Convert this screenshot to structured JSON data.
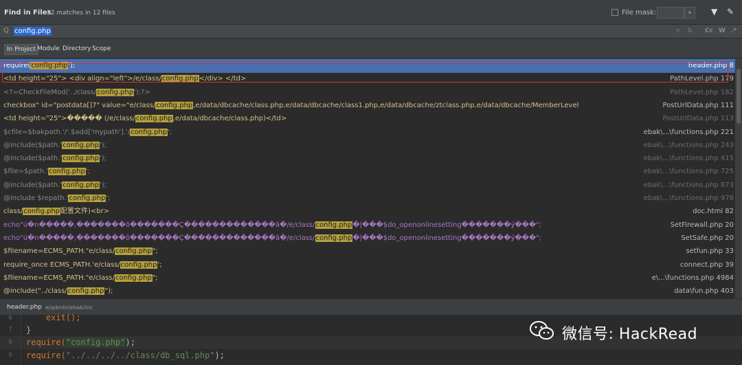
{
  "window": {
    "title": "Find in Files",
    "subtitle": "32 matches in 12 files",
    "file_mask_label": "File mask:",
    "file_mask_value": ""
  },
  "search": {
    "query": "config.php",
    "case_label": "Cc",
    "word_label": "W",
    "regex_label": ".*"
  },
  "scopes": [
    "In Project",
    "Module",
    "Directory",
    "Scope"
  ],
  "results": [
    {
      "pre": "require(",
      "match": "config.php",
      "post": "');",
      "loc": "header.php 8",
      "style": "normal",
      "loc_dim": false
    },
    {
      "pre": "<td height=\"25\">  <div align=\"left\">/e/class/",
      "match": "config.php",
      "post": "</div> </td>",
      "loc": "PathLevel.php 179",
      "style": "normal",
      "loc_dim": false
    },
    {
      "pre": "<?=CheckFileMod('../class/",
      "match": "config.php",
      "post": "');?>",
      "loc": "PathLevel.php 182",
      "style": "dim",
      "loc_dim": true
    },
    {
      "pre": "checkbox\" id=\"postdata[]7\" value=\"e/class/",
      "match": "config.php",
      "post": ",e/data/dbcache/class.php,e/data/dbcache/class1.php,e/data/dbcache/ztclass.php,e/data/dbcache/MemberLevel",
      "loc": "PostUrlData.php 111",
      "style": "normal",
      "loc_dim": false
    },
    {
      "pre": "<td height=\"25\">�����  (/e/class/",
      "match": "config.php",
      "post": ",e/data/dbcache/class.php)</td>",
      "loc": "PostUrlData.php 113",
      "style": "normal",
      "loc_dim": true
    },
    {
      "pre": "$cfile=$bakpath.'/'.$add['mypath'].'/",
      "match": "config.php",
      "post": "';",
      "loc": "ebak\\...\\functions.php 221",
      "style": "dim",
      "loc_dim": false
    },
    {
      "pre": "@include($path.'",
      "match": "config.php",
      "post": "');",
      "loc": "ebak\\...\\functions.php 243",
      "style": "dim",
      "loc_dim": true
    },
    {
      "pre": "@include($path.'",
      "match": "config.php",
      "post": "');",
      "loc": "ebak\\...\\functions.php 415",
      "style": "dim",
      "loc_dim": true
    },
    {
      "pre": "$file=$path.'",
      "match": "config.php",
      "post": "';",
      "loc": "ebak\\...\\functions.php 725",
      "style": "dim",
      "loc_dim": true
    },
    {
      "pre": "@include($path.'",
      "match": "config.php",
      "post": "');",
      "loc": "ebak\\...\\functions.php 873",
      "style": "dim",
      "loc_dim": true
    },
    {
      "pre": "@include $repath.'",
      "match": "config.php",
      "post": "';",
      "loc": "ebak\\...\\functions.php 978",
      "style": "dim",
      "loc_dim": true
    },
    {
      "pre": "class/",
      "match": "config.php",
      "post": "配置文件)<br>",
      "loc": "doc.html 82",
      "style": "normal",
      "loc_dim": false
    },
    {
      "pre": "echo\"ú�n�����,�������ô�������Ç�������������ã�/e/class/",
      "match": "config.php",
      "post": "�|���$do_openonlinesetting�������ý���\";",
      "loc": "SetFirewall.php 20",
      "style": "purple",
      "loc_dim": false
    },
    {
      "pre": "echo\"ú�n�����,�������ô�������Ç�������������ã�/e/class/",
      "match": "config.php",
      "post": "�|���$do_openonlinesetting�������ý���\";",
      "loc": "SetSafe.php 20",
      "style": "purple",
      "loc_dim": false
    },
    {
      "pre": "$filename=ECMS_PATH.\"e/class/",
      "match": "config.php",
      "post": "\";",
      "loc": "setfun.php 33",
      "style": "normal",
      "loc_dim": false
    },
    {
      "pre": "require_once ECMS_PATH.'e/class/",
      "match": "config.php",
      "post": "';",
      "loc": "connect.php 39",
      "style": "normal",
      "loc_dim": false
    },
    {
      "pre": "$filename=ECMS_PATH.\"e/class/",
      "match": "config.php",
      "post": "\";",
      "loc": "e\\...\\functions.php 4984",
      "style": "normal",
      "loc_dim": false
    },
    {
      "pre": "@include(\"../class/",
      "match": "config.php",
      "post": "\");",
      "loc": "data\\fun.php 403",
      "style": "normal",
      "loc_dim": false
    }
  ],
  "preview": {
    "file": "header.php",
    "dir": "e/admin/ebak/inc",
    "lines": [
      {
        "num": "6",
        "code": "    exit();"
      },
      {
        "num": "7",
        "code": "}"
      },
      {
        "num": "8",
        "kw": "require(",
        "str": "\"config.php\"",
        "end": ");"
      },
      {
        "num": "9",
        "kw": "require(",
        "str": "\"../../../../class/db_sql.php\"",
        "end": ");"
      }
    ]
  },
  "watermark": "微信号: HackRead",
  "colors": {
    "selection": "#4b6eaf",
    "match_highlight": "#b5a03e",
    "annotation_box": "#d9362d"
  }
}
